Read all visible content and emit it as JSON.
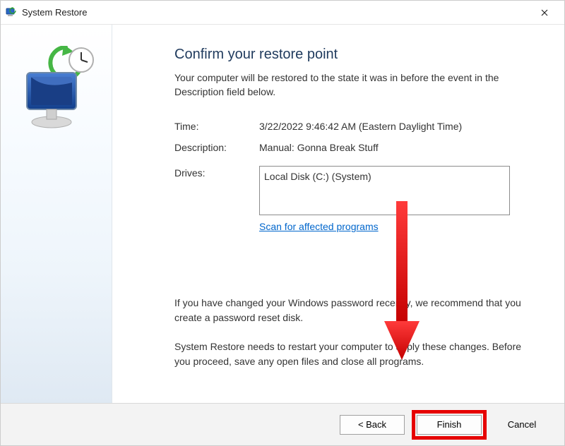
{
  "window": {
    "title": "System Restore"
  },
  "header": {
    "heading": "Confirm your restore point",
    "subtitle": "Your computer will be restored to the state it was in before the event in the Description field below."
  },
  "info": {
    "time_label": "Time:",
    "time_value": "3/22/2022 9:46:42 AM (Eastern Daylight Time)",
    "description_label": "Description:",
    "description_value": "Manual: Gonna Break Stuff",
    "drives_label": "Drives:",
    "drives_items": [
      "Local Disk (C:) (System)"
    ],
    "scan_link": "Scan for affected programs"
  },
  "notes": {
    "password_note": "If you have changed your Windows password recently, we recommend that you create a password reset disk.",
    "restart_note": "System Restore needs to restart your computer to apply these changes. Before you proceed, save any open files and close all programs."
  },
  "footer": {
    "back_label": "< Back",
    "finish_label": "Finish",
    "cancel_label": "Cancel"
  }
}
